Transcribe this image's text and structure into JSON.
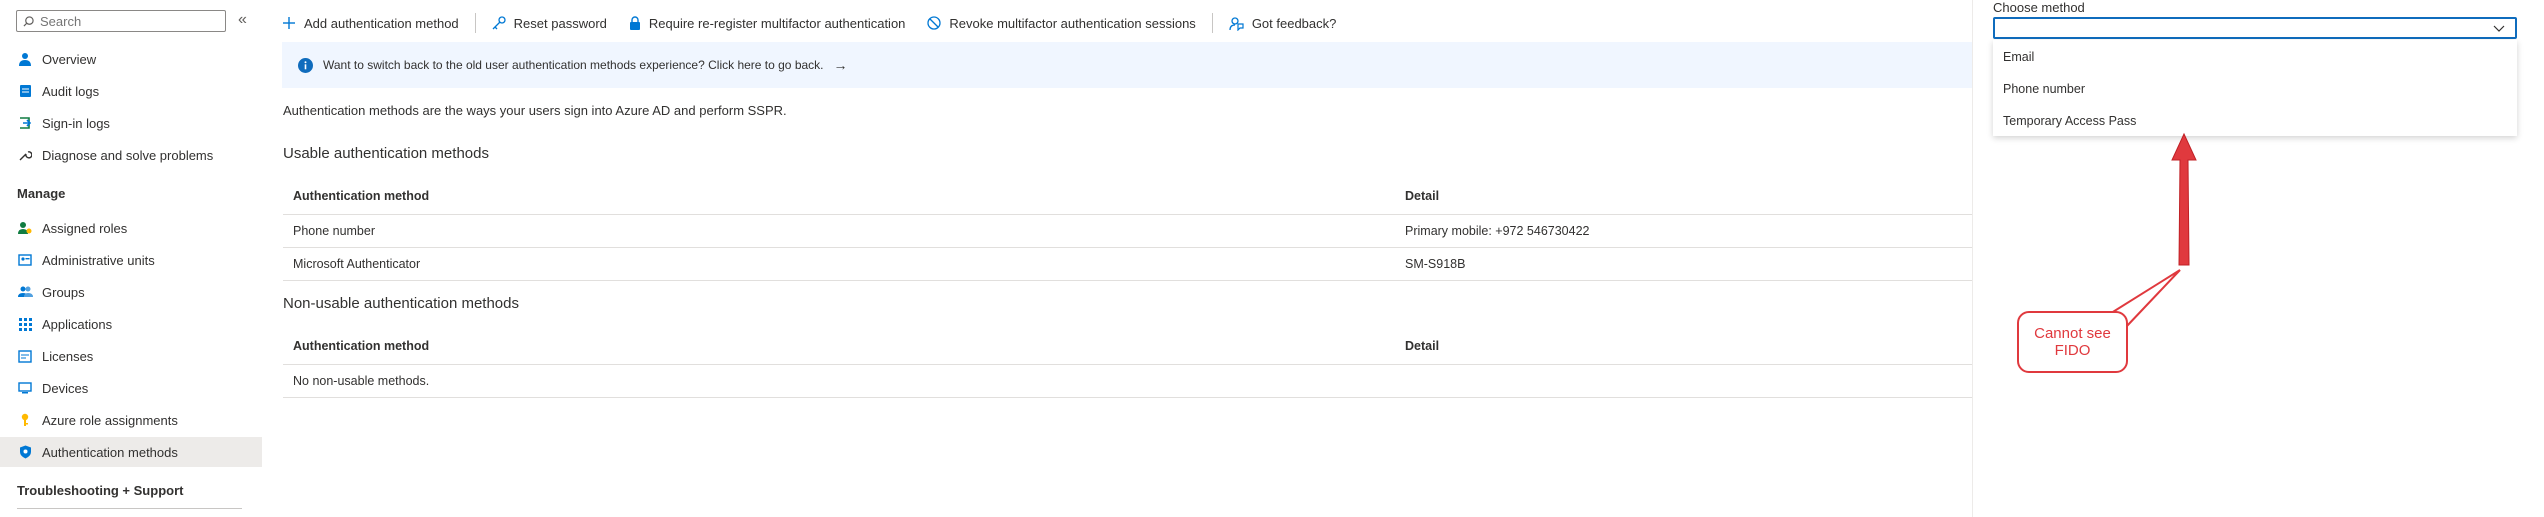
{
  "sidebar": {
    "search": {
      "placeholder": "Search",
      "value": ""
    },
    "collapse_label": "«",
    "items": [
      {
        "label": "Overview",
        "icon": "user-icon"
      },
      {
        "label": "Audit logs",
        "icon": "audit-log-icon"
      },
      {
        "label": "Sign-in logs",
        "icon": "sign-in-log-icon"
      },
      {
        "label": "Diagnose and solve problems",
        "icon": "wrench-icon"
      }
    ],
    "manage_header": "Manage",
    "manage_items": [
      {
        "label": "Assigned roles",
        "icon": "assigned-roles-icon"
      },
      {
        "label": "Administrative units",
        "icon": "administrative-units-icon"
      },
      {
        "label": "Groups",
        "icon": "groups-icon"
      },
      {
        "label": "Applications",
        "icon": "applications-grid-icon"
      },
      {
        "label": "Licenses",
        "icon": "licenses-icon"
      },
      {
        "label": "Devices",
        "icon": "devices-icon"
      },
      {
        "label": "Azure role assignments",
        "icon": "key-icon"
      },
      {
        "label": "Authentication methods",
        "icon": "shield-icon",
        "active": true
      }
    ],
    "troubleshooting_header": "Troubleshooting + Support"
  },
  "toolbar": {
    "add_label": "Add authentication method",
    "reset_label": "Reset password",
    "reregister_label": "Require re-register multifactor authentication",
    "revoke_label": "Revoke multifactor authentication sessions",
    "feedback_label": "Got feedback?"
  },
  "banner": {
    "text": "Want to switch back to the old user authentication methods experience? Click here to go back.",
    "arrow": "→"
  },
  "description": "Authentication methods are the ways your users sign into Azure AD and perform SSPR.",
  "usable": {
    "title": "Usable authentication methods",
    "columns": [
      "Authentication method",
      "Detail"
    ],
    "rows": [
      [
        "Phone number",
        "Primary mobile: +972 546730422"
      ],
      [
        "Microsoft Authenticator",
        "SM-S918B"
      ]
    ]
  },
  "non_usable": {
    "title": "Non-usable authentication methods",
    "columns": [
      "Authentication method",
      "Detail"
    ],
    "rows": [
      [
        "No non-usable methods.",
        ""
      ]
    ]
  },
  "panel": {
    "label": "Choose method",
    "selected": "",
    "options": [
      "Email",
      "Phone number",
      "Temporary Access Pass"
    ]
  },
  "annotation": {
    "callout_text": "Cannot see\nFIDO",
    "color": "#e0393e"
  },
  "colors": {
    "accent": "#0f6cbd",
    "banner_bg": "#f0f6ff",
    "active_bg": "#edebe9",
    "annotation_red": "#e0393e"
  }
}
